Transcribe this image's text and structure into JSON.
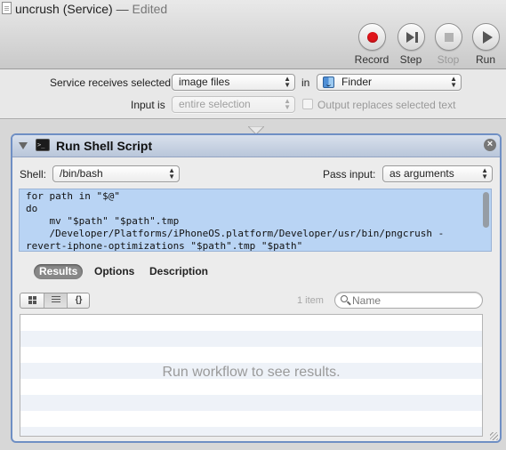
{
  "window": {
    "title": "uncrush (Service)",
    "separator": "—",
    "edited": "Edited"
  },
  "toolbar": {
    "record_label": "Record",
    "step_label": "Step",
    "stop_label": "Stop",
    "run_label": "Run",
    "record_color": "#e0141a"
  },
  "service": {
    "receives_label": "Service receives selected",
    "receives_value": "image files",
    "in_label": "in",
    "app_value": "Finder",
    "app_icon": "finder-icon",
    "input_is_label": "Input is",
    "input_is_value": "entire selection",
    "output_replaces_label": "Output replaces selected text",
    "output_replaces_checked": false
  },
  "action": {
    "title": "Run Shell Script",
    "icon": "terminal-icon",
    "shell_label": "Shell:",
    "shell_value": "/bin/bash",
    "pass_input_label": "Pass input:",
    "pass_input_value": "as arguments",
    "script": "for path in \"$@\"\ndo\n    mv \"$path\" \"$path\".tmp\n    /Developer/Platforms/iPhoneOS.platform/Developer/usr/bin/pngcrush -\nrevert-iphone-optimizations \"$path\".tmp \"$path\"",
    "tabs": [
      {
        "label": "Results",
        "selected": true
      },
      {
        "label": "Options",
        "selected": false
      },
      {
        "label": "Description",
        "selected": false
      }
    ],
    "view_buttons": [
      "grid-view-icon",
      "list-view-icon",
      "braces-view-icon"
    ],
    "view_braces_text": "{}",
    "item_count": "1 item",
    "search_placeholder": "Name",
    "empty_message": "Run workflow to see results."
  },
  "colors": {
    "selection_blue": "#b9d4f4",
    "panel_border": "#6f8fc4"
  }
}
